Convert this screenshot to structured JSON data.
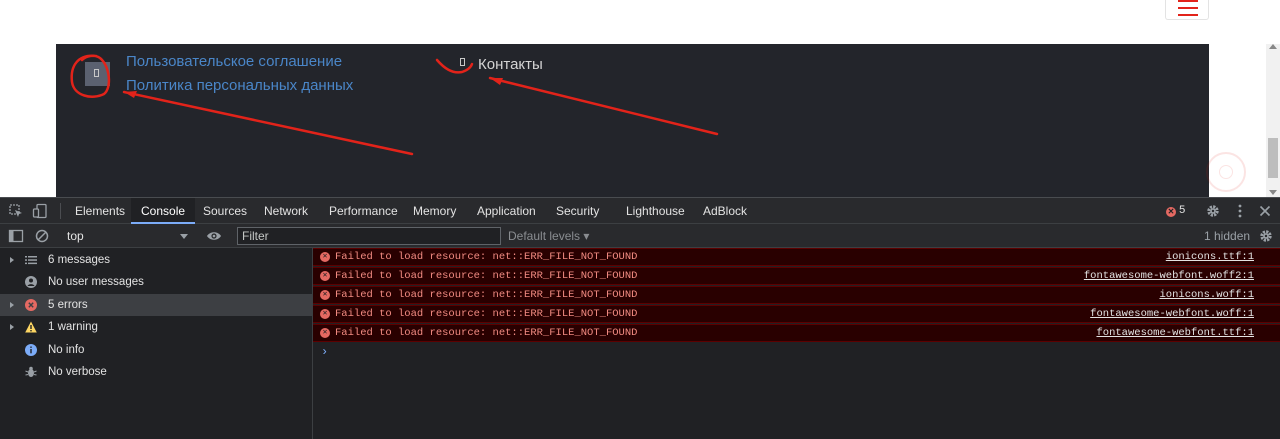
{
  "website": {
    "footer_links": [
      "Пользовательское соглашение",
      "Политика персональных данных"
    ],
    "contacts_label": "Контакты",
    "brand_color": "#e2231a",
    "link_color": "#4a86c8",
    "footer_bg": "#23252b",
    "icons": {
      "menu": "hamburger-icon",
      "broken_glyph": "missing-glyph-icon",
      "back_to_top": "back-to-top-icon"
    }
  },
  "devtools": {
    "tabs": [
      "Elements",
      "Console",
      "Sources",
      "Network",
      "Performance",
      "Memory",
      "Application",
      "Security",
      "Lighthouse",
      "AdBlock"
    ],
    "active_tab": "Console",
    "error_count": "5",
    "context": "top",
    "filter_placeholder": "Filter",
    "levels_label": "Default levels ▾",
    "hidden_label": "1 hidden",
    "sidebar": [
      {
        "label": "6 messages",
        "icon": "list-icon"
      },
      {
        "label": "No user messages",
        "icon": "user-icon"
      },
      {
        "label": "5 errors",
        "icon": "error-icon"
      },
      {
        "label": "1 warning",
        "icon": "warning-icon"
      },
      {
        "label": "No info",
        "icon": "info-icon"
      },
      {
        "label": "No verbose",
        "icon": "bug-icon"
      }
    ],
    "messages": [
      {
        "text": "Failed to load resource: net::ERR_FILE_NOT_FOUND",
        "source": "ionicons.ttf:1"
      },
      {
        "text": "Failed to load resource: net::ERR_FILE_NOT_FOUND",
        "source": "fontawesome-webfont.woff2:1"
      },
      {
        "text": "Failed to load resource: net::ERR_FILE_NOT_FOUND",
        "source": "ionicons.woff:1"
      },
      {
        "text": "Failed to load resource: net::ERR_FILE_NOT_FOUND",
        "source": "fontawesome-webfont.woff:1"
      },
      {
        "text": "Failed to load resource: net::ERR_FILE_NOT_FOUND",
        "source": "fontawesome-webfont.ttf:1"
      }
    ],
    "prompt": "›",
    "colors": {
      "error_text": "#f28b82",
      "error_bg": "#290000",
      "accent": "#7cacf8"
    }
  }
}
